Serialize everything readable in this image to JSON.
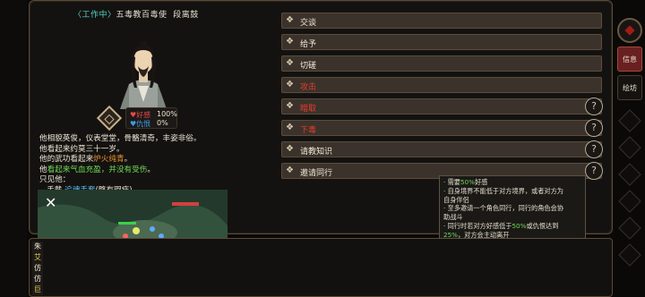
{
  "header": {
    "status": "〈工作中〉",
    "faction_role": "五毒教百毒使",
    "name": "段离鼓"
  },
  "relations": {
    "favor_label": "好感",
    "favor_value": "100%",
    "hatred_label": "仇恨",
    "hatred_value": "0%"
  },
  "description": {
    "l1": "他相貌英俊，仪表堂堂，骨骼清奇，丰姿非俗。",
    "l2": "他看起来约莫三十一岁。",
    "l3_a": "他的武功看起来",
    "l3_b": "炉火纯青",
    "l3_c": "。",
    "l4_a": "他",
    "l4_b": "看起来气血充盈，并没有受伤",
    "l4_c": "。",
    "l5": "只见他：",
    "l6_a": "手戴",
    "l6_b": "追魂手套",
    "l6_c": "(略有瑕疵)"
  },
  "menu": [
    {
      "label": "交谈",
      "style": "normal",
      "has_help": false
    },
    {
      "label": "给予",
      "style": "normal",
      "has_help": false
    },
    {
      "label": "切磋",
      "style": "normal",
      "has_help": false
    },
    {
      "label": "攻击",
      "style": "red",
      "has_help": false
    },
    {
      "label": "暗取",
      "style": "red",
      "has_help": true
    },
    {
      "label": "下毒",
      "style": "red",
      "has_help": true
    },
    {
      "label": "请教知识",
      "style": "normal",
      "has_help": true
    },
    {
      "label": "邀请同行",
      "style": "normal",
      "has_help": true
    }
  ],
  "help_glyph": "?",
  "tooltip": {
    "t1_a": "· 需要",
    "t1_b": "50%",
    "t1_c": "好感",
    "t2": "· 自身境界不能低于对方境界，或者对方为",
    "t3": "  自身伴侣",
    "t4": "· 至多邀请一个角色同行，同行的角色会协",
    "t5": "  助战斗",
    "t6_a": "· 同行时若对方好感低于",
    "t6_b": "50%",
    "t6_c": "或仇恨达到",
    "t7_a": "  ",
    "t7_b": "25%",
    "t7_c": "，对方会主动离开"
  },
  "right_rail": {
    "tab_info": "信息",
    "tab_book": "绘坊"
  },
  "video_overlay": {
    "close_glyph": "✕"
  },
  "bottom_left": {
    "chars": [
      "朱",
      "艾",
      "仿",
      "仿",
      "巨",
      "仿",
      "昌"
    ]
  },
  "colors": {
    "accent_red": "#e83a2c",
    "favor_red": "#e24a4a",
    "hatred_blue": "#3f9ee8",
    "status_cyan": "#4fd8c7",
    "highlight_orange": "#e8902f",
    "highlight_green": "#6fd858",
    "item_cyan": "#56c7ff"
  }
}
